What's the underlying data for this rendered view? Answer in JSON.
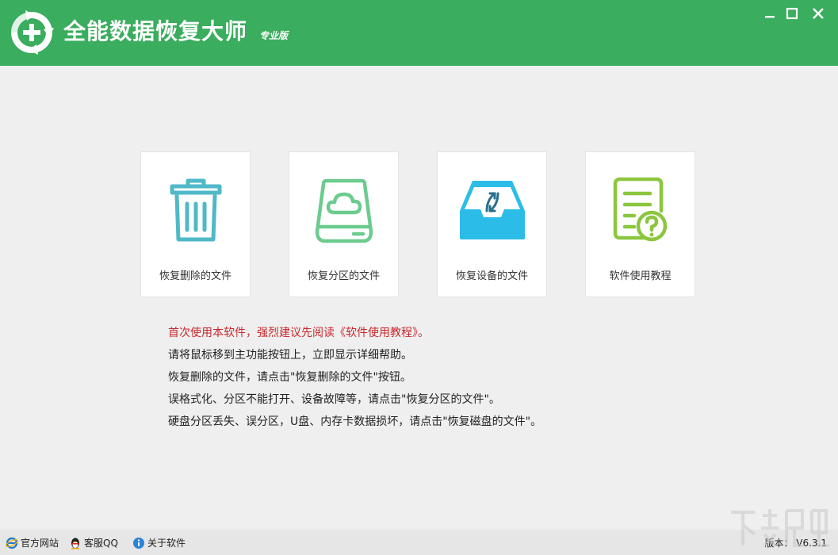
{
  "app": {
    "title": "全能数据恢复大师",
    "edition": "专业版"
  },
  "window_controls": [
    "minimize",
    "maximize",
    "close"
  ],
  "colors": {
    "titlebar": "#3aad5e",
    "trash": "#4fb9c8",
    "drive": "#6ccb8f",
    "device": "#2bbde8",
    "guide": "#8cc63f",
    "warning_text": "#c8282d"
  },
  "cards": [
    {
      "label": "恢复删除的文件",
      "icon": "trash-icon"
    },
    {
      "label": "恢复分区的文件",
      "icon": "cloud-drive-icon"
    },
    {
      "label": "恢复设备的文件",
      "icon": "device-tray-icon"
    },
    {
      "label": "软件使用教程",
      "icon": "guide-document-icon"
    }
  ],
  "help": {
    "lines": [
      "首次使用本软件，强烈建议先阅读《软件使用教程》。",
      "请将鼠标移到主功能按钮上，立即显示详细帮助。",
      "恢复删除的文件，请点击\"恢复删除的文件\"按钮。",
      "误格式化、分区不能打开、设备故障等，请点击\"恢复分区的文件\"。",
      "硬盘分区丢失、误分区，U盘、内存卡数据损坏，请点击\"恢复磁盘的文件\"。"
    ]
  },
  "footer": {
    "links": [
      {
        "label": "官方网站",
        "icon": "ie-browser-icon"
      },
      {
        "label": "客服QQ",
        "icon": "qq-penguin-icon"
      },
      {
        "label": "关于软件",
        "icon": "info-icon"
      }
    ],
    "version": "版本： V6.3.1"
  }
}
